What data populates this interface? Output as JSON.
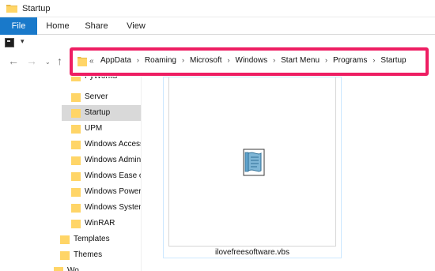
{
  "window": {
    "title": "Startup"
  },
  "ribbon": {
    "tabs": [
      "File",
      "Home",
      "Share",
      "View"
    ]
  },
  "qat": {
    "dropdown_glyph": "▾"
  },
  "nav": {
    "back": "←",
    "forward": "→",
    "recent": "⌄",
    "up": "↑"
  },
  "address": {
    "overflow": "«",
    "crumbs": [
      "AppData",
      "Roaming",
      "Microsoft",
      "Windows",
      "Start Menu",
      "Programs",
      "Startup"
    ],
    "separator": "›"
  },
  "tree": {
    "items": [
      {
        "label": "PyWorkS"
      },
      {
        "label": "Server"
      },
      {
        "label": "Startup",
        "selected": true
      },
      {
        "label": "UPM"
      },
      {
        "label": "Windows Access"
      },
      {
        "label": "Windows Admin"
      },
      {
        "label": "Windows Ease o"
      },
      {
        "label": "Windows Power"
      },
      {
        "label": "Windows System"
      },
      {
        "label": "WinRAR"
      },
      {
        "label": "Templates"
      },
      {
        "label": "Themes"
      },
      {
        "label": "Wo"
      }
    ]
  },
  "file": {
    "name": "ilovefreesoftware.vbs",
    "icon": "script-icon"
  },
  "colors": {
    "file_tab": "#1979ca",
    "highlight": "#ee1e63",
    "folder": "#ffd567",
    "selected": "#d9d9d9"
  }
}
